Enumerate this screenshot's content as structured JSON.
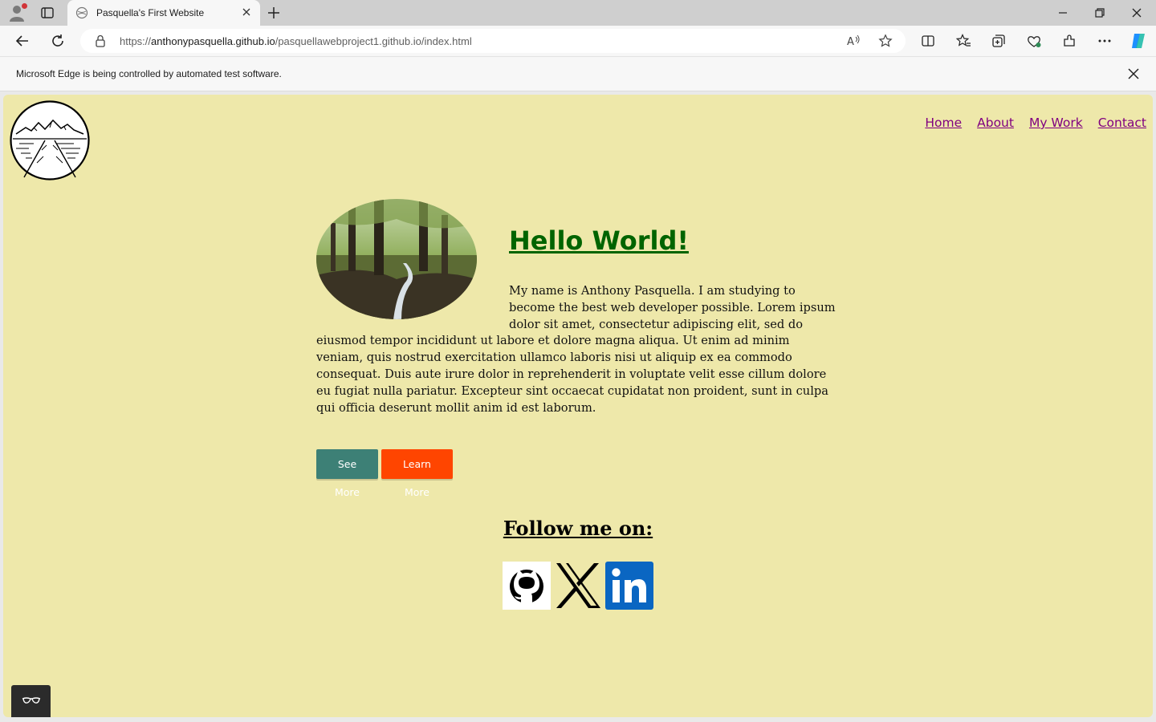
{
  "browser": {
    "tab_title": "Pasquella's First Website",
    "url_prefix": "https://",
    "url_host": "anthonypasquella.github.io",
    "url_path": "/pasquellawebproject1.github.io/index.html",
    "infobar_message": "Microsoft Edge is being controlled by automated test software."
  },
  "nav": {
    "items": [
      "Home",
      "About",
      "My Work",
      "Contact"
    ]
  },
  "hero": {
    "heading": "Hello World!",
    "bio": "My name is Anthony Pasquella. I am studying to become the best web developer possible. Lorem ipsum dolor sit amet, consectetur adipiscing elit, sed do eiusmod tempor incididunt ut labore et dolore magna aliqua. Ut enim ad minim veniam, quis nostrud exercitation ullamco laboris nisi ut aliquip ex ea commodo consequat. Duis aute irure dolor in reprehenderit in voluptate velit esse cillum dolore eu fugiat nulla pariatur. Excepteur sint occaecat cupidatat non proident, sunt in culpa qui officia deserunt mollit anim id est laborum.",
    "see_more_label": "See More",
    "learn_more_label": "Learn More"
  },
  "follow": {
    "heading": "Follow me on:",
    "icons": [
      "github-icon",
      "x-icon",
      "linkedin-icon"
    ]
  },
  "colors": {
    "page_background": "#eee8aa",
    "heading_green": "#006400",
    "nav_link": "#800080",
    "see_more_button": "#3d8076",
    "learn_more_button": "#ff4500",
    "linkedin_blue": "#0a66c2"
  }
}
